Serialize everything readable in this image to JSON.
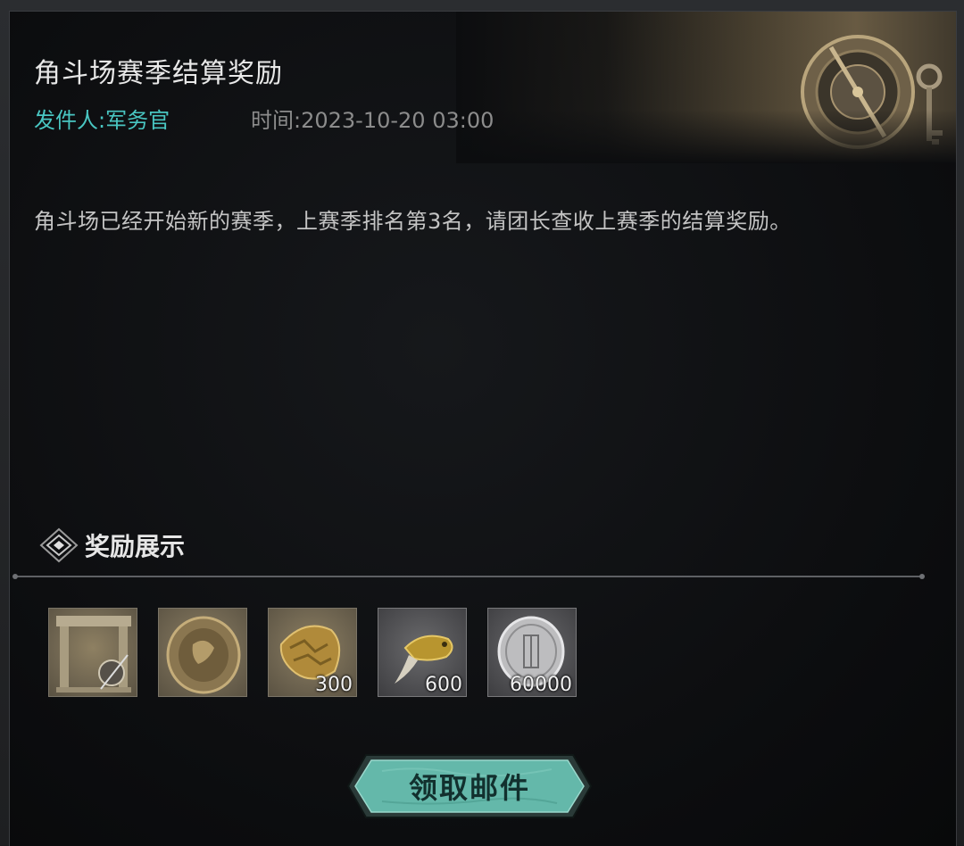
{
  "mail": {
    "title": "角斗场赛季结算奖励",
    "sender": "发件人:军务官",
    "time": "时间:2023-10-20 03:00",
    "body": "角斗场已经开始新的赛季，上赛季排名第3名，请团长查收上赛季的结算奖励。"
  },
  "rewards_section": {
    "title": "奖励展示",
    "items": [
      {
        "icon": "stone-frame-shield-icon",
        "quantity": ""
      },
      {
        "icon": "bronze-medallion-icon",
        "quantity": ""
      },
      {
        "icon": "golden-scale-icon",
        "quantity": "300"
      },
      {
        "icon": "golden-beast-claw-icon",
        "quantity": "600"
      },
      {
        "icon": "silver-coin-icon",
        "quantity": "60000"
      }
    ]
  },
  "actions": {
    "claim_label": "领取邮件"
  },
  "colors": {
    "accent_teal": "#49c6c2",
    "button_teal": "#5fb8a8",
    "panel_bg": "#0c0d0f"
  }
}
